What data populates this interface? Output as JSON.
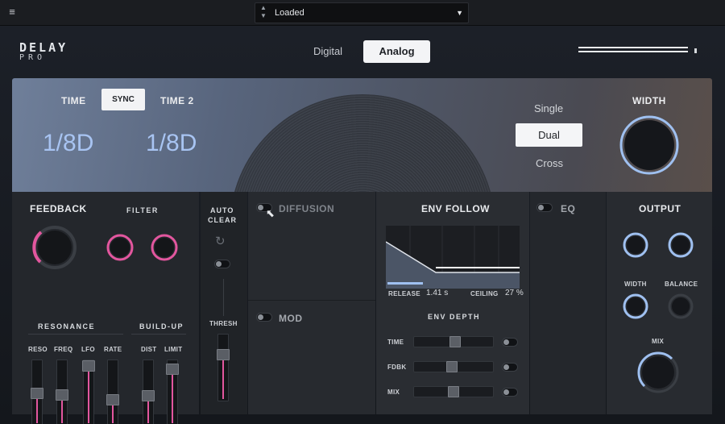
{
  "host": {
    "menu_icon": "hamburger-menu-icon",
    "preset": "Loaded"
  },
  "header": {
    "logo_line1": "DELAY",
    "logo_line2": "PRO",
    "modes": [
      "Digital",
      "Analog"
    ],
    "selected_mode": "Analog"
  },
  "time": {
    "time_label": "TIME",
    "sync_label": "SYNC",
    "time2_label": "TIME 2",
    "time_value": "1/8D",
    "time2_value": "1/8D"
  },
  "routing": {
    "options": [
      "Single",
      "Dual",
      "Cross"
    ],
    "selected": "Dual"
  },
  "width_label": "WIDTH",
  "feedback": {
    "title": "FEEDBACK",
    "filter_title": "FILTER",
    "resonance_title": "RESONANCE",
    "buildup_title": "BUILD-UP",
    "fader_labels": [
      "RESO",
      "FREQ",
      "LFO",
      "RATE",
      "DIST",
      "LIMIT"
    ]
  },
  "auto_clear": {
    "title_line1": "AUTO",
    "title_line2": "CLEAR",
    "thresh_label": "THRESH"
  },
  "diffusion_label": "DIFFUSION",
  "mod_label": "MOD",
  "env_follow": {
    "title": "ENV FOLLOW",
    "release_label": "RELEASE",
    "release_value": "1.41 s",
    "ceiling_label": "CEILING",
    "ceiling_value": "27 %"
  },
  "env_depth": {
    "title": "ENV DEPTH",
    "rows": [
      "TIME",
      "FDBK",
      "MIX"
    ]
  },
  "eq_label": "EQ",
  "output": {
    "title": "OUTPUT",
    "width_label": "WIDTH",
    "balance_label": "BALANCE",
    "mix_label": "MIX"
  },
  "colors": {
    "accent_pink": "#e2569e",
    "accent_blue": "#9fc0f0",
    "time_value": "#a8c4f2"
  }
}
